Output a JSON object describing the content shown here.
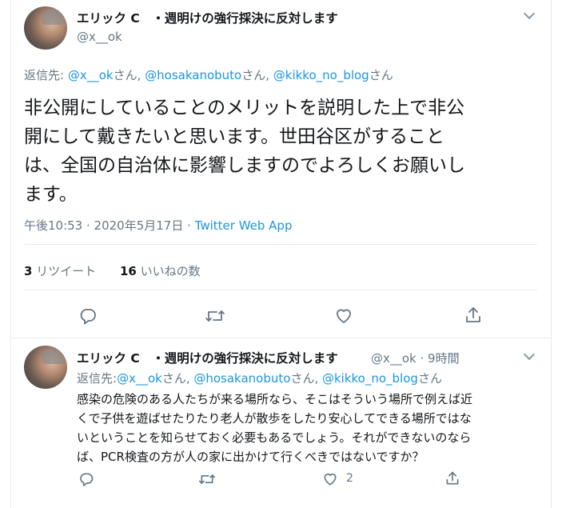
{
  "main_tweet": {
    "display_name": "エリック C　・週明けの強行採決に反対します",
    "handle": "@x__ok",
    "reply_to_label": "返信先:",
    "reply_to_1": "@x__ok",
    "reply_to_sep1": "さん, ",
    "reply_to_2": "@hosakanobuto",
    "reply_to_sep2": "さん, ",
    "reply_to_3": "@kikko_no_blog",
    "reply_to_suffix": "さん",
    "text_line1": "非公開にしていることのメリットを説明した上で非公",
    "text_line2": "開にして戴きたいと思います。世田谷区がすること",
    "text_line3": "は、全国の自治体に影響しますのでよろしくお願いし",
    "text_line4": "ます。",
    "timestamp": "午後10:53 · 2020年5月17日 · ",
    "source": "Twitter Web App",
    "retweets_count": "3",
    "retweets_label": "リツイート",
    "likes_count": "16",
    "likes_label": "いいねの数"
  },
  "reply_tweet": {
    "display_name": "エリック C　・週明けの強行採決に反対します",
    "handle_time": "@x__ok · 9時間",
    "reply_to_label": "返信先:",
    "reply_to_1": "@x__ok",
    "reply_to_sep1": "さん, ",
    "reply_to_2": "@hosakanobuto",
    "reply_to_sep2": "さん, ",
    "reply_to_3": "@kikko_no_blog",
    "reply_to_suffix": "さん",
    "text_line1": "感染の危険のある人たちが来る場所なら、そこはそういう場所で例えば近",
    "text_line2": "くで子供を遊ばせたりたり老人が散歩をしたり安心してできる場所ではな",
    "text_line3": "いということを知らせておく必要もあるでしょう。それができないのなら",
    "text_line4": "ば、PCR検査の方が人の家に出かけて行くべきではないですか？",
    "like_count": "2"
  },
  "colors": {
    "accent": "#1b95e0",
    "muted": "#657786",
    "icon": "#657786"
  }
}
